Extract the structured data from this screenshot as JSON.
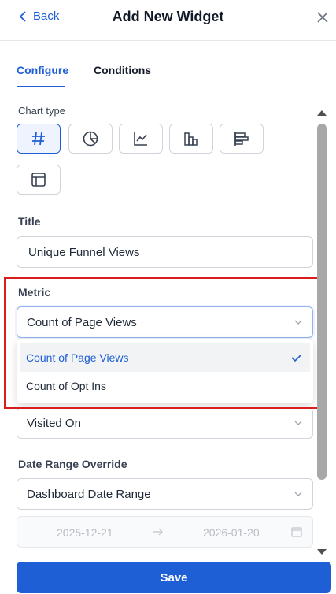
{
  "header": {
    "back_label": "Back",
    "title": "Add New Widget"
  },
  "tabs": [
    {
      "label": "Configure",
      "active": true
    },
    {
      "label": "Conditions",
      "active": false
    }
  ],
  "chart_type": {
    "label": "Chart type",
    "options": [
      {
        "icon": "number-icon",
        "active": true
      },
      {
        "icon": "pie-chart-icon",
        "active": false
      },
      {
        "icon": "line-chart-icon",
        "active": false
      },
      {
        "icon": "bar-chart-icon",
        "active": false
      },
      {
        "icon": "horizontal-bar-chart-icon",
        "active": false
      },
      {
        "icon": "table-icon",
        "active": false
      }
    ]
  },
  "title_field": {
    "label": "Title",
    "value": "Unique Funnel Views"
  },
  "metric": {
    "label": "Metric",
    "value": "Count of Page Views",
    "options": [
      {
        "label": "Count of Page Views",
        "selected": true
      },
      {
        "label": "Count of Opt Ins",
        "selected": false
      }
    ]
  },
  "date_field": {
    "value": "Visited On"
  },
  "date_range_override": {
    "label": "Date Range Override",
    "value": "Dashboard Date Range",
    "start": "2025-12-21",
    "end": "2026-01-20"
  },
  "save_label": "Save",
  "colors": {
    "accent": "#1f5fd6",
    "highlight": "#d91c1c"
  }
}
